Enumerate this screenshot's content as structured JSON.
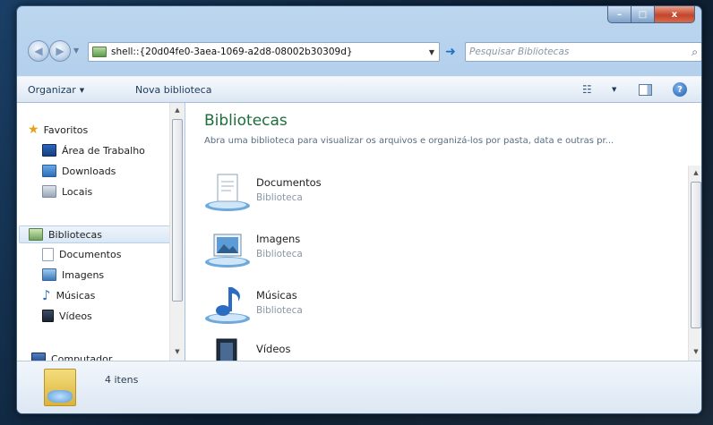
{
  "window": {
    "buttons": {
      "minimize": "–",
      "maximize": "□",
      "close": "x"
    }
  },
  "nav": {
    "back_icon": "back-arrow-icon",
    "forward_icon": "forward-arrow-icon",
    "address": "shell::{20d04fe0-3aea-1069-a2d8-08002b30309d}",
    "go_symbol": "➜",
    "search_placeholder": "Pesquisar Bibliotecas"
  },
  "toolbar": {
    "organize_label": "Organizar",
    "new_library_label": "Nova biblioteca"
  },
  "sidebar": {
    "items": [
      {
        "label": "Favoritos",
        "icon": "star-icon"
      },
      {
        "label": "Área de Trabalho",
        "icon": "desktop-icon"
      },
      {
        "label": "Downloads",
        "icon": "downloads-icon"
      },
      {
        "label": "Locais",
        "icon": "places-icon"
      },
      {
        "label": "Bibliotecas",
        "icon": "libraries-icon"
      },
      {
        "label": "Documentos",
        "icon": "documents-icon"
      },
      {
        "label": "Imagens",
        "icon": "images-icon"
      },
      {
        "label": "Músicas",
        "icon": "music-icon"
      },
      {
        "label": "Vídeos",
        "icon": "videos-icon"
      },
      {
        "label": "Computador",
        "icon": "computer-icon"
      }
    ]
  },
  "main": {
    "title": "Bibliotecas",
    "description": "Abra uma biblioteca para visualizar os arquivos e organizá-los por pasta, data e outras pr...",
    "libraries": [
      {
        "name": "Documentos",
        "type": "Biblioteca"
      },
      {
        "name": "Imagens",
        "type": "Biblioteca"
      },
      {
        "name": "Músicas",
        "type": "Biblioteca"
      },
      {
        "name": "Vídeos",
        "type": ""
      }
    ]
  },
  "details": {
    "count": "4 itens"
  },
  "colors": {
    "title_green": "#1e6e3b",
    "accent_blue": "#2c6fc4"
  }
}
